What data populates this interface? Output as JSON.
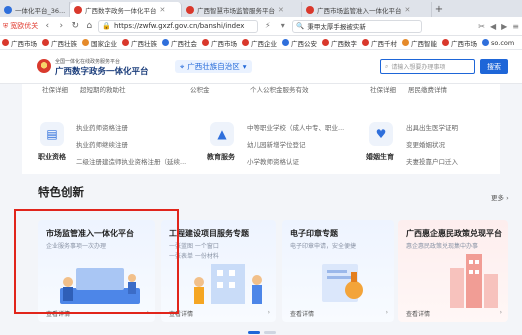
{
  "browser": {
    "tabs": [
      {
        "label": "一体化平台_36...",
        "active": false
      },
      {
        "label": "广西数字政务一体化平台",
        "active": true
      },
      {
        "label": "广西智慧市场监管服务平台",
        "active": false
      },
      {
        "label": "广西市场监管准入一体化平台",
        "active": false
      }
    ],
    "new_tab": "+",
    "security_label": "宽欧优关",
    "url": "https://zwfw.gxzf.gov.cn/banshi/index",
    "search_query": "秉甲太厚手报被实新",
    "bookmarks": [
      "广西市场",
      "广西壮族",
      "国家企业",
      "广西壮族",
      "广西社会",
      "广西市场",
      "广西企业",
      "广西公安",
      "广西数字",
      "广西千村",
      "广西智能",
      "广西市场",
      "so.com"
    ]
  },
  "site": {
    "subtitle": "全国一体化在线政务服务平台",
    "title": "广西数字政务一体化平台",
    "region": "广西壮族自治区",
    "search_placeholder": "请输入想要办理事项",
    "search_button": "搜索"
  },
  "services": {
    "top_cut": [
      "社保详细",
      "超短期的救助社",
      "公积金",
      "个人公积金服务有效",
      "社保详细",
      "居民缴费详情"
    ],
    "items": [
      {
        "name": "职业资格",
        "lines": [
          "执业药师资格注册",
          "执业药师继续注册",
          "二级注册建造师执业资格注册（延续..."
        ]
      },
      {
        "name": "教育服务",
        "lines": [
          "中等职业学校（成人中专、职业...",
          "幼儿园新增学位登记",
          "小学教师资格认证"
        ]
      },
      {
        "name": "婚姻生育",
        "lines": [
          "出具出生医学证明",
          "变更婚姻状况",
          "夫妻投靠户口迁入"
        ]
      }
    ]
  },
  "featured": {
    "title": "特色创新",
    "more": "更多",
    "cards": [
      {
        "title": "市场监管准入一体化平台",
        "subtitle": "企业服务事项一次办理",
        "subtitle2": "",
        "link": "查看详情"
      },
      {
        "title": "工程建设项目服务专题",
        "subtitle": "一张蓝图 一个窗口",
        "subtitle2": "一张表单 一份材料",
        "link": "查看详情"
      },
      {
        "title": "电子印章专题",
        "subtitle": "电子印章申请，安全便捷",
        "subtitle2": "",
        "link": "查看详情"
      },
      {
        "title": "广西惠企惠民政策兑现平台",
        "subtitle": "惠企惠民政策兑现集中办事",
        "subtitle2": "",
        "link": "查看详情"
      }
    ]
  },
  "colors": {
    "accent": "#1e66d8",
    "highlight": "#e1251b"
  }
}
